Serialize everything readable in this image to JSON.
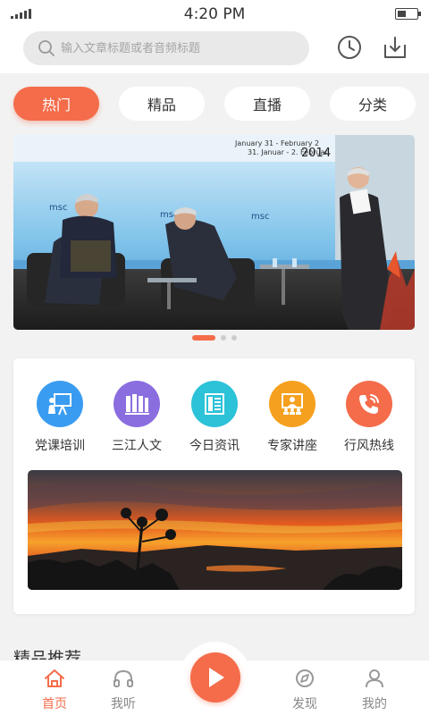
{
  "status_bar": {
    "time": "4:20 PM"
  },
  "search": {
    "placeholder": "输入文章标题或者音频标题"
  },
  "top_icons": [
    "history-icon",
    "download-icon"
  ],
  "tabs": [
    {
      "label": "热门",
      "active": true
    },
    {
      "label": "精品",
      "active": false
    },
    {
      "label": "直播",
      "active": false
    },
    {
      "label": "分类",
      "active": false
    }
  ],
  "banner": {
    "backdrop_text": "January 31 - February 2 2014",
    "backdrop_text_2": "31. Januar - 2. Februar",
    "logo_text": "msc",
    "slides_count": 3,
    "active_slide": 1
  },
  "categories": [
    {
      "label": "党课培训",
      "color": "#3a9cf0",
      "icon": "presentation-icon"
    },
    {
      "label": "三江人文",
      "color": "#8a6ee0",
      "icon": "books-icon"
    },
    {
      "label": "今日资讯",
      "color": "#2cc2d8",
      "icon": "news-icon"
    },
    {
      "label": "专家讲座",
      "color": "#f5a01e",
      "icon": "lecture-icon"
    },
    {
      "label": "行风热线",
      "color": "#f46c4a",
      "icon": "phone-icon"
    }
  ],
  "section": {
    "title": "精品推荐"
  },
  "bottom_nav": [
    {
      "label": "首页",
      "icon": "home-icon",
      "active": true
    },
    {
      "label": "我听",
      "icon": "headphones-icon",
      "active": false
    },
    {
      "label": "发现",
      "icon": "discover-icon",
      "active": false
    },
    {
      "label": "我的",
      "icon": "profile-icon",
      "active": false
    }
  ],
  "colors": {
    "accent": "#f46c4a",
    "background": "#f2f2f2"
  }
}
